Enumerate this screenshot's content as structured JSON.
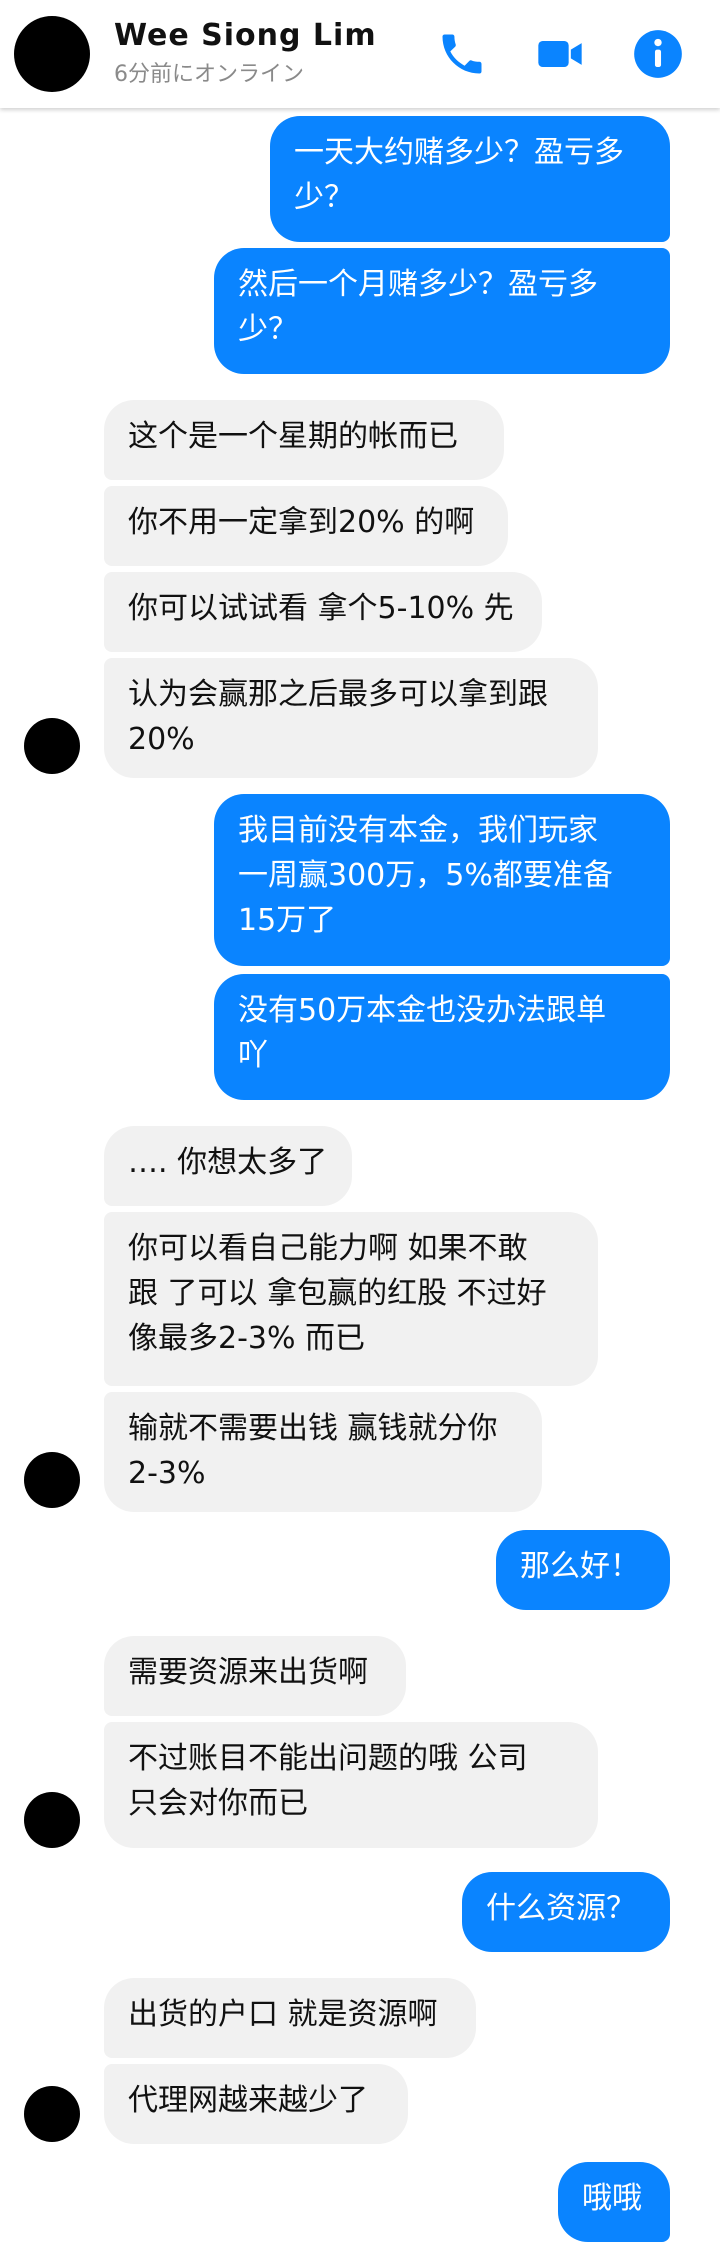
{
  "header": {
    "name": "Wee Siong Lim",
    "status": "6分前にオンライン",
    "call_icon": "phone-icon",
    "video_icon": "video-camera-icon",
    "info_icon": "info-icon",
    "accent": "#0a84ff"
  },
  "messages": [
    {
      "side": "out",
      "lines": [
        "一天大约赌多少？盈亏多",
        "少？"
      ]
    },
    {
      "side": "out",
      "lines": [
        "然后一个月赌多少？盈亏多",
        "少？"
      ]
    },
    {
      "side": "in",
      "lines": [
        "这个是一个星期的帐而已"
      ]
    },
    {
      "side": "in",
      "lines": [
        "你不用一定拿到20% 的啊"
      ]
    },
    {
      "side": "in",
      "lines": [
        "你可以试试看 拿个5-10% 先"
      ]
    },
    {
      "side": "in",
      "lines": [
        "认为会赢那之后最多可以拿到跟",
        "20%"
      ]
    },
    {
      "side": "out",
      "lines": [
        "我目前没有本金，我们玩家",
        "一周赢300万，5%都要准备",
        "15万了"
      ]
    },
    {
      "side": "out",
      "lines": [
        "没有50万本金也没办法跟单",
        "吖"
      ]
    },
    {
      "side": "in",
      "lines": [
        "…. 你想太多了"
      ]
    },
    {
      "side": "in",
      "lines": [
        "你可以看自己能力啊 如果不敢",
        "跟 了可以 拿包赢的红股 不过好",
        "像最多2-3% 而已"
      ]
    },
    {
      "side": "in",
      "lines": [
        "输就不需要出钱 赢钱就分你",
        "2-3%"
      ]
    },
    {
      "side": "out",
      "lines": [
        "那么好！"
      ]
    },
    {
      "side": "in",
      "lines": [
        "需要资源来出货啊"
      ]
    },
    {
      "side": "in",
      "lines": [
        "不过账目不能出问题的哦 公司",
        "只会对你而已"
      ]
    },
    {
      "side": "out",
      "lines": [
        "什么资源？"
      ]
    },
    {
      "side": "in",
      "lines": [
        "出货的户口 就是资源啊"
      ]
    },
    {
      "side": "in",
      "lines": [
        "代理网越来越少了"
      ]
    },
    {
      "side": "out",
      "lines": [
        "哦哦"
      ]
    }
  ]
}
